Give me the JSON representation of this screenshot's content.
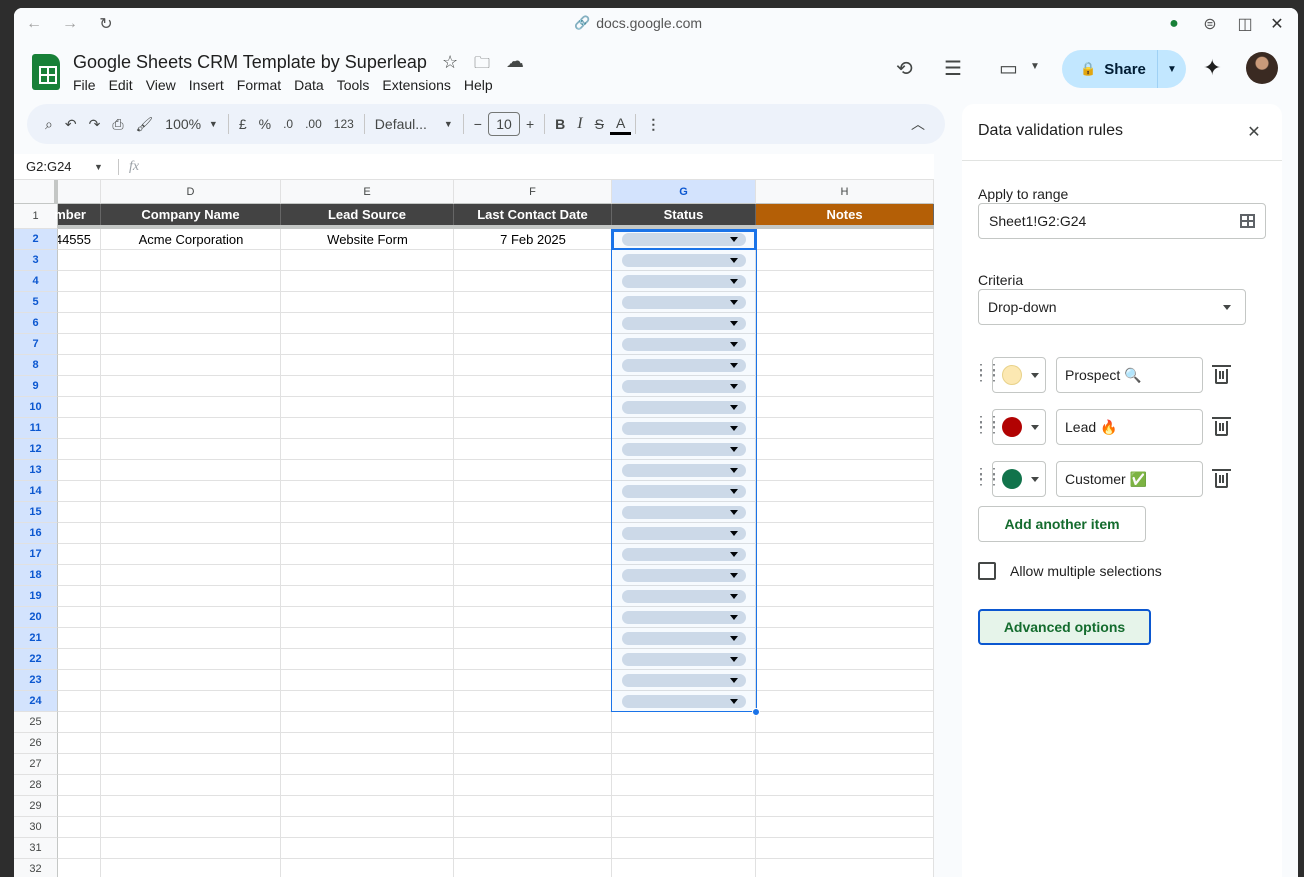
{
  "browser": {
    "url": "docs.google.com"
  },
  "doc": {
    "title": "Google Sheets CRM Template by Superleap",
    "menu": [
      "File",
      "Edit",
      "View",
      "Insert",
      "Format",
      "Data",
      "Tools",
      "Extensions",
      "Help"
    ],
    "share_label": "Share"
  },
  "toolbar": {
    "zoom": "100%",
    "currency": "£",
    "percent": "%",
    "dec_decrease": ".0",
    "dec_increase": ".00",
    "number_format": "123",
    "font": "Defaul...",
    "font_size": "10",
    "bold": "B",
    "italic": "I",
    "strike": "S",
    "text_color": "A"
  },
  "formula_bar": {
    "name_box": "G2:G24",
    "fx": "fx"
  },
  "sheet": {
    "columns": [
      "D",
      "E",
      "F",
      "G",
      "H"
    ],
    "headers": [
      "mber",
      "Company Name",
      "Lead Source",
      "Last Contact Date",
      "Status",
      "Notes"
    ],
    "row2": [
      "44555",
      "Acme Corporation",
      "Website Form",
      "7 Feb 2025"
    ],
    "row_numbers": [
      "1",
      "2",
      "3",
      "4",
      "5",
      "6",
      "7",
      "8",
      "9",
      "10",
      "11",
      "12",
      "13",
      "14",
      "15",
      "16",
      "17",
      "18",
      "19",
      "20",
      "21",
      "22",
      "23",
      "24",
      "25",
      "26",
      "27",
      "28",
      "29",
      "30",
      "31",
      "32"
    ]
  },
  "panel": {
    "title": "Data validation rules",
    "apply_label": "Apply to range",
    "range_value": "Sheet1!G2:G24",
    "criteria_label": "Criteria",
    "criteria_value": "Drop-down",
    "items": [
      {
        "value": "Prospect 🔍",
        "color": "#fce8b2"
      },
      {
        "value": "Lead 🔥",
        "color": "#b10202"
      },
      {
        "value": "Customer ✅",
        "color": "#11734b"
      }
    ],
    "add_item": "Add another item",
    "allow_multiple": "Allow multiple selections",
    "advanced": "Advanced options"
  },
  "icons": [
    "back-icon",
    "forward-icon",
    "reload-icon",
    "link-icon",
    "star-icon",
    "move-folder-icon",
    "cloud-icon",
    "history-icon",
    "comment-icon",
    "meet-icon",
    "lock-icon",
    "gemini-icon",
    "search-icon",
    "undo-icon",
    "redo-icon",
    "print-icon",
    "paint-format-icon",
    "close-icon",
    "grid-icon",
    "drag-handle-icon",
    "trash-icon"
  ]
}
